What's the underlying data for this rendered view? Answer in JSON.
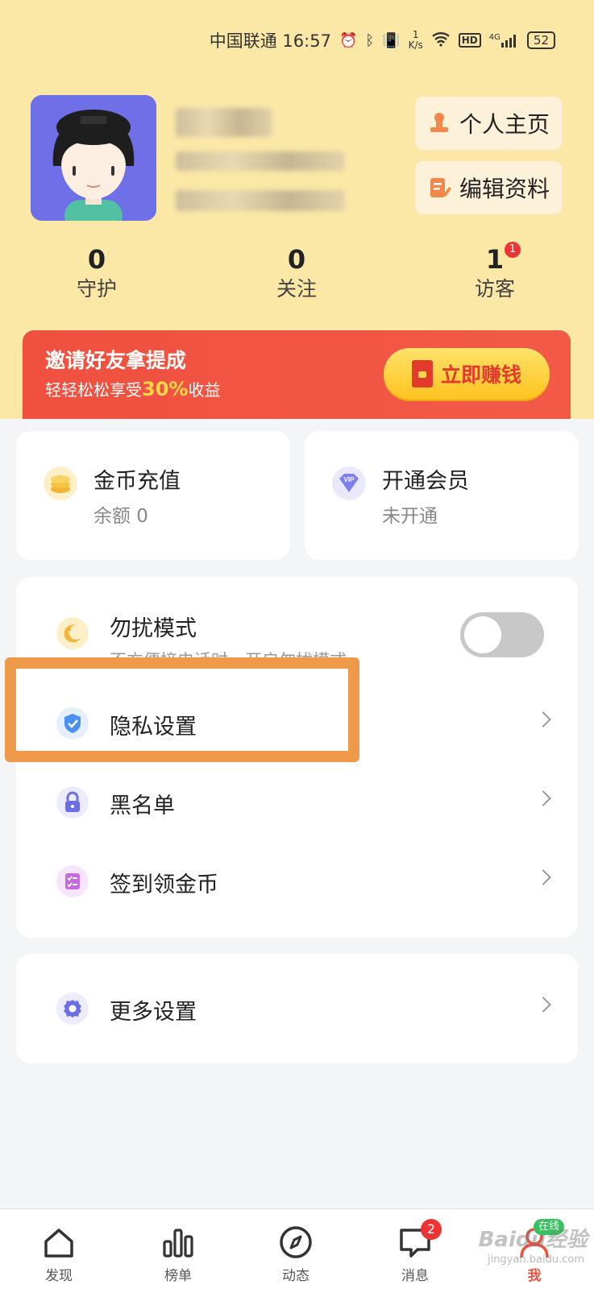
{
  "status_bar": {
    "carrier_time": "中国联通 16:57",
    "speed_value": "1",
    "speed_unit": "K/s",
    "network": "4G",
    "battery": "52"
  },
  "profile": {
    "visit_page_label": "个人主页",
    "edit_profile_label": "编辑资料"
  },
  "stats": [
    {
      "value": "0",
      "label": "守护"
    },
    {
      "value": "0",
      "label": "关注"
    },
    {
      "value": "1",
      "label": "访客",
      "badge": "1"
    }
  ],
  "invite": {
    "title": "邀请好友拿提成",
    "sub_prefix": "轻轻松松享受",
    "sub_highlight": "30%",
    "sub_suffix": "收益",
    "button_label": "立即赚钱"
  },
  "quick_actions": [
    {
      "title": "金币充值",
      "subtitle": "余额 0",
      "icon": "coins-icon"
    },
    {
      "title": "开通会员",
      "subtitle": "未开通",
      "icon": "vip-icon"
    }
  ],
  "settings": {
    "dnd_label": "勿扰模式",
    "dnd_sub": "不方便接电话时，开启勿扰模式",
    "dnd_enabled": false,
    "privacy_label": "隐私设置",
    "blacklist_label": "黑名单",
    "checkin_label": "签到领金币",
    "more_label": "更多设置"
  },
  "bottom_nav": [
    {
      "label": "发现",
      "icon": "home-icon"
    },
    {
      "label": "榜单",
      "icon": "ranking-icon"
    },
    {
      "label": "动态",
      "icon": "compass-icon"
    },
    {
      "label": "消息",
      "icon": "message-icon",
      "badge": "2"
    },
    {
      "label": "我",
      "icon": "user-icon",
      "badge": "在线",
      "active": true
    }
  ],
  "watermark": {
    "brand": "Baidu经验",
    "url": "jingyan.baidu.com"
  },
  "colors": {
    "header_bg": "#fbe7a6",
    "accent_red": "#f0503f",
    "highlight_orange": "#ef9a4b",
    "online_green": "#35c25f"
  }
}
